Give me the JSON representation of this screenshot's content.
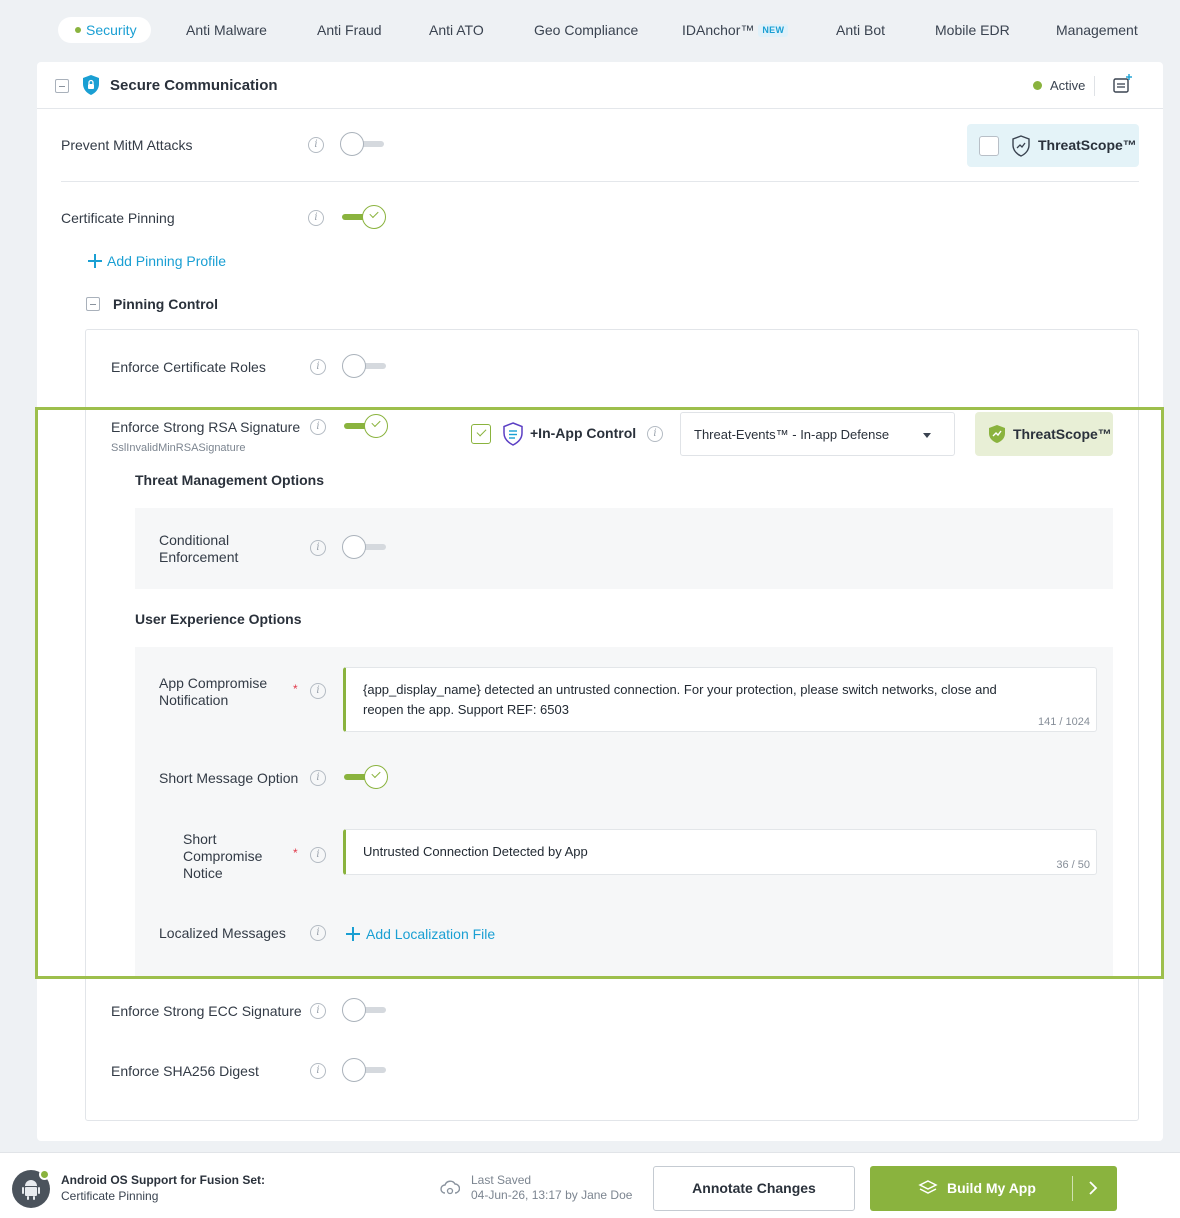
{
  "tabs": [
    {
      "label": "Security",
      "active": true
    },
    {
      "label": "Anti Malware"
    },
    {
      "label": "Anti Fraud"
    },
    {
      "label": "Anti ATO"
    },
    {
      "label": "Geo Compliance"
    },
    {
      "label": "IDAnchor™",
      "badge": "NEW"
    },
    {
      "label": "Anti Bot"
    },
    {
      "label": "Mobile EDR"
    },
    {
      "label": "Management"
    }
  ],
  "section": {
    "title": "Secure Communication",
    "status": "Active",
    "status_color": "#8ab33e"
  },
  "rows": {
    "mitm": {
      "label": "Prevent MitM Attacks",
      "enabled": false,
      "threatscope_label": "ThreatScope™"
    },
    "cert_pinning": {
      "label": "Certificate Pinning",
      "enabled": true
    },
    "add_pinning_profile": "Add Pinning Profile",
    "pinning_control": "Pinning Control",
    "enforce_cert_roles": {
      "label": "Enforce Certificate Roles",
      "enabled": false
    },
    "rsa": {
      "label": "Enforce Strong RSA Signature",
      "sublabel": "SslInvalidMinRSASignature",
      "enabled": true,
      "in_app_control": "+In-App Control",
      "select_value": "Threat-Events™ - In-app Defense",
      "threatscope_label": "ThreatScope™"
    },
    "threat_mgmt": {
      "heading": "Threat Management Options",
      "conditional": {
        "label_line1": "Conditional",
        "label_line2": "Enforcement",
        "enabled": false
      }
    },
    "ux": {
      "heading": "User Experience Options",
      "app_notification": {
        "label_line1": "App Compromise",
        "label_line2": "Notification",
        "value_line1": "{app_display_name} detected an untrusted connection. For your protection, please switch networks, close and",
        "value_line2": "reopen the app. Support REF: 6503",
        "counter": "141 / 1024"
      },
      "short_option": {
        "label": "Short Message Option",
        "enabled": true
      },
      "short_notice": {
        "label_line1": "Short",
        "label_line2": "Compromise",
        "label_line3": "Notice",
        "value": "Untrusted Connection Detected by App",
        "counter": "36 / 50"
      },
      "localized": {
        "label": "Localized Messages",
        "link": "Add Localization File"
      }
    },
    "ecc": {
      "label": "Enforce Strong ECC Signature",
      "enabled": false
    },
    "sha256": {
      "label": "Enforce SHA256 Digest",
      "enabled": false
    }
  },
  "required_marker": "*",
  "footer": {
    "support_title": "Android OS Support for Fusion Set:",
    "support_value": "Certificate Pinning",
    "last_saved_label": "Last Saved",
    "last_saved_value": "04-Jun-26, 13:17 by Jane Doe",
    "annotate_button": "Annotate Changes",
    "build_button": "Build My App"
  },
  "colors": {
    "accent_green": "#8ab33e",
    "link_blue": "#1a9fd3",
    "highlight_border": "#9dbf4c"
  }
}
